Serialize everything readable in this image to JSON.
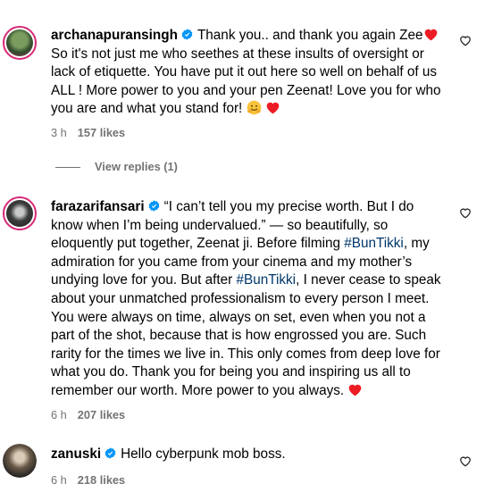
{
  "comments": [
    {
      "username": "archanapuransingh",
      "text_before_emoji": "Thank you.. and thank you again Zee",
      "text_main": "So it's not just me who seethes at these insults of oversight or lack of etiquette. You have put it out here so well on behalf of us ALL ! More power to you and your pen Zeenat! Love you for who you are and what you stand for!",
      "time": "3 h",
      "likes": "157 likes",
      "view_replies": "View replies (1)"
    },
    {
      "username": "farazarifansari",
      "text_a": "“I can’t tell you my precise worth. But I do know when I’m being undervalued.” — so beautifully, so eloquently put together, Zeenat ji. Before filming ",
      "hashtag1": "#BunTikki",
      "text_b": ", my admiration for you came from your cinema and my mother’s undying love for you. But after ",
      "hashtag2": "#BunTikki",
      "text_c": ", I never cease to speak about your unmatched professionalism to every person I meet. You were always on time, always on set, even when you not a part of the shot, because that is how engrossed you are. Such rarity for the times we live in. This only comes from deep love for what you do. Thank you for being you and inspiring us all to remember our worth. More power to you always. ",
      "time": "6 h",
      "likes": "207 likes"
    },
    {
      "username": "zanuski",
      "text": "Hello cyberpunk mob boss.",
      "time": "6 h",
      "likes": "218 likes"
    }
  ],
  "icons": {
    "verified": "verified-badge-icon",
    "like": "heart-outline-icon",
    "heart": "red-heart-emoji",
    "hug": "hugging-face-emoji"
  },
  "colors": {
    "verified": "#0095f6",
    "heart": "#ed1c24",
    "meta": "#737373",
    "hashtag": "#00376b"
  }
}
